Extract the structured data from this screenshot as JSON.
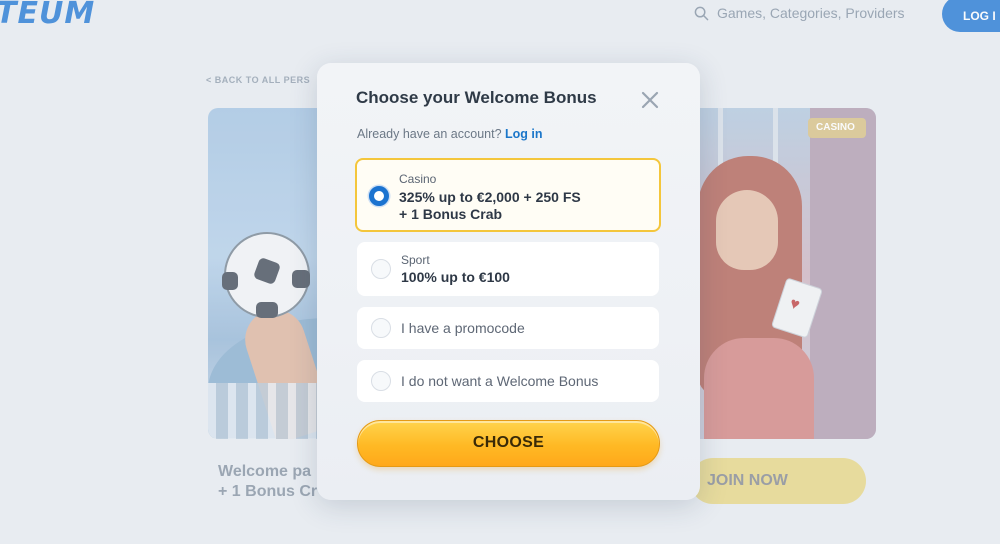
{
  "background": {
    "logo_text": "TEUM",
    "search_placeholder": "Games, Categories, Providers",
    "login_label": "LOG I",
    "back_link": "< BACK TO ALL PERS",
    "category_tag": "CASINO",
    "promo_text_line1": "Welcome pa",
    "promo_text_line2": "+ 1 Bonus Cr",
    "join_label": "JOIN NOW"
  },
  "modal": {
    "title": "Choose your Welcome Bonus",
    "account_prompt": "Already have an account?",
    "login_link": "Log in",
    "options": [
      {
        "category": "Casino",
        "line1": "325% up to €2,000 + 250 FS",
        "line2": "+ 1 Bonus Crab",
        "selected": true
      },
      {
        "category": "Sport",
        "line1": "100% up to €100",
        "selected": false
      },
      {
        "label": "I have a promocode",
        "selected": false
      },
      {
        "label": "I do not want a Welcome Bonus",
        "selected": false
      }
    ],
    "choose_label": "CHOOSE"
  },
  "colors": {
    "accent_blue": "#1b73d0",
    "selected_border": "#f4c63b",
    "button_yellow": "#ffb924"
  },
  "icons": [
    "search-icon",
    "close-icon",
    "radio-selected-icon",
    "radio-empty-icon"
  ]
}
